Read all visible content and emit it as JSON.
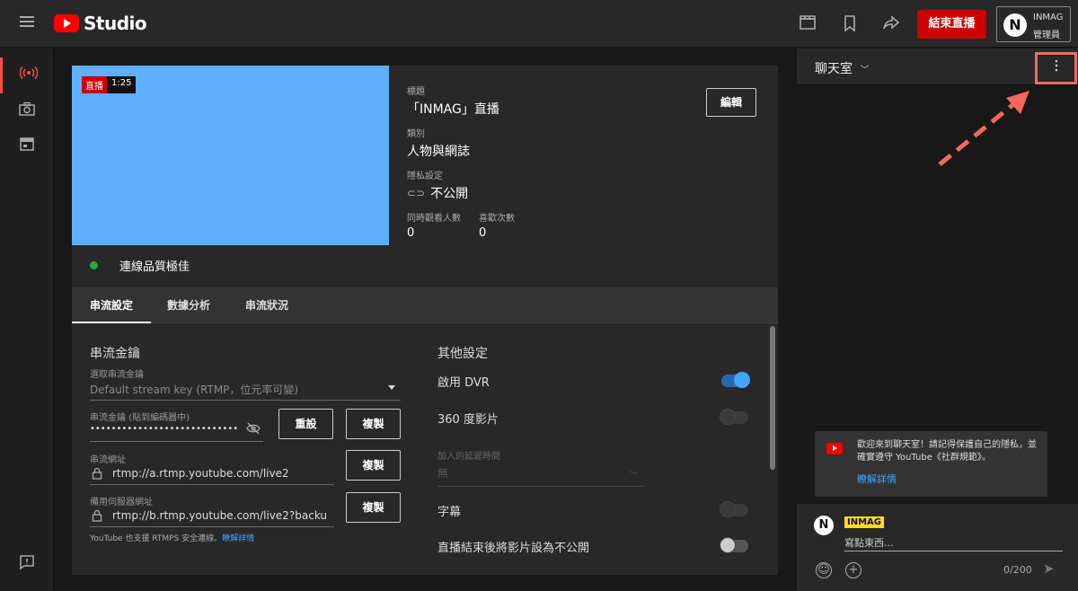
{
  "header": {
    "studio": "Studio",
    "end_stream": "結束直播",
    "user_name": "INMAG",
    "user_role": "管理員",
    "avatar_letter": "N"
  },
  "stream": {
    "badge_live": "直播",
    "badge_time": "1:25",
    "quality": "連線品質極佳",
    "title_label": "標題",
    "title": "「INMAG」直播",
    "category_label": "類別",
    "category": "人物與網誌",
    "privacy_label": "隱私設定",
    "privacy": "不公開",
    "viewers_label": "同時觀看人數",
    "viewers": "0",
    "likes_label": "喜歡次數",
    "likes": "0",
    "edit": "編輯"
  },
  "tabs": [
    "串流設定",
    "數據分析",
    "串流狀況"
  ],
  "key_section": {
    "title": "串流金鑰",
    "select_label": "選取串流金鑰",
    "select_value": "Default stream key (RTMP，位元率可變)",
    "key_label": "串流金鑰 (貼到編碼器中)",
    "key_value": "••••••••••••••••••••••••••••",
    "reset": "重設",
    "copy": "複製",
    "url_label": "串流網址",
    "url_value": "rtmp://a.rtmp.youtube.com/live2",
    "backup_label": "備用伺服器網址",
    "backup_value": "rtmp://b.rtmp.youtube.com/live2?backu",
    "rtmps_note": "YouTube 也支援 RTMPS 安全連線。",
    "learn_more": "瞭解詳情"
  },
  "other_section": {
    "title": "其他設定",
    "dvr": "啟用 DVR",
    "dvr_on": true,
    "vr360": "360 度影片",
    "vr360_on": false,
    "delay_label": "加入的延遲時間",
    "delay_value": "無",
    "captions": "字幕",
    "captions_on": false,
    "unlist": "直播結束後將影片設為不公開",
    "unlist_on": false
  },
  "chat": {
    "title": "聊天室",
    "notice": "歡迎來到聊天室！請記得保護自己的隱私，並確實遵守 YouTube《社群規範》。",
    "learn_more": "瞭解詳情",
    "user": "INMAG",
    "placeholder": "寫點東西...",
    "count": "0/200"
  },
  "colors": {
    "accent_red": "#cc0000",
    "toggle_blue": "#3ea6ff",
    "annotation": "#f2695c",
    "preview": "#5eb0ff"
  }
}
